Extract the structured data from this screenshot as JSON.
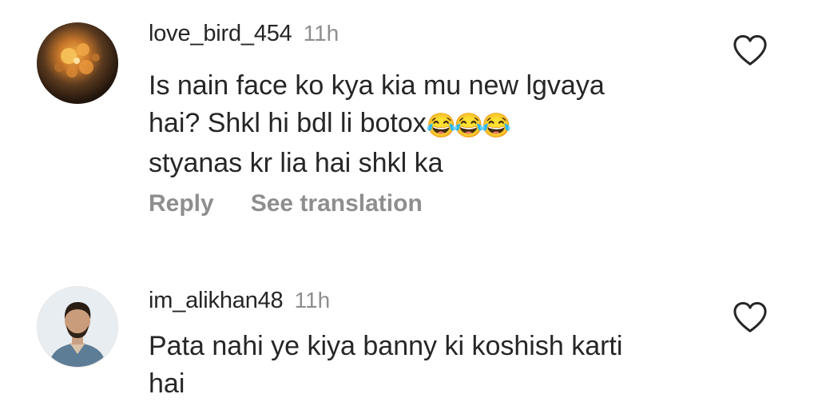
{
  "comments": [
    {
      "username": "love_bird_454",
      "time": "11h",
      "text_lines": [
        "Is nain face ko kya kia mu new lgvaya",
        "hai? Shkl hi bdl li botox",
        "styanas kr lia hai shkl ka"
      ],
      "emoji": "😂😂😂",
      "reply_label": "Reply",
      "translation_label": "See translation",
      "avatar_icon": "flower-photo-avatar",
      "like_icon": "heart-outline-icon"
    },
    {
      "username": "im_alikhan48",
      "time": "11h",
      "text_lines": [
        "Pata nahi ye kiya banny ki koshish karti",
        "hai"
      ],
      "avatar_icon": "man-photo-avatar",
      "like_icon": "heart-outline-icon"
    }
  ],
  "colors": {
    "text": "#262626",
    "secondary": "#8e8e8e",
    "background": "#ffffff"
  }
}
